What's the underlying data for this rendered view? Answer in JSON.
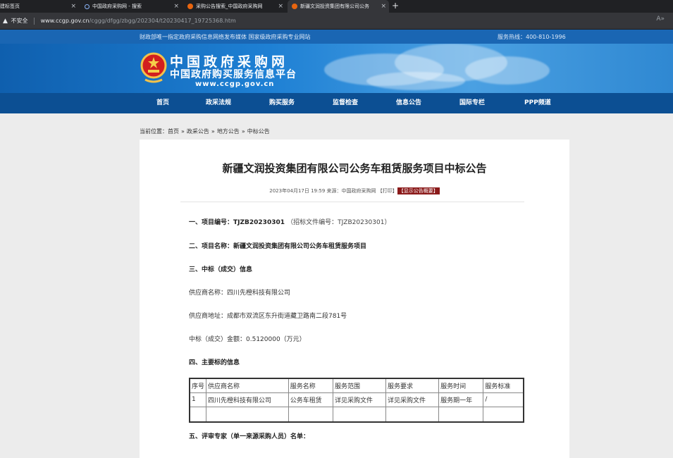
{
  "browser": {
    "tabs": [
      {
        "title": "建标签页",
        "active": false
      },
      {
        "title": "中国政府采购网 - 搜索",
        "active": false
      },
      {
        "title": "采购公告搜索_中国政府采购网",
        "active": false
      },
      {
        "title": "新疆文润投资集团有限公司公务",
        "active": true
      }
    ],
    "security_label": "不安全",
    "url_host": "www.ccgp.gov.cn",
    "url_path": "/cggg/dfgg/zbgg/202304/t20230417_19725368.htm"
  },
  "header": {
    "tagline": "财政部唯一指定政府采购信息网络发布媒体 国家级政府采购专业网站",
    "hotline": "服务热线：400-810-1996",
    "logo_line1": "中国政府采购网",
    "logo_line2": "中国政府购买服务信息平台",
    "logo_en": "www.ccgp.gov.cn"
  },
  "nav": [
    "首页",
    "政采法规",
    "购买服务",
    "监督检查",
    "信息公告",
    "国际专栏",
    "PPP频道"
  ],
  "breadcrumb": {
    "label": "当前位置：",
    "items": [
      "首页",
      "政采公告",
      "地方公告",
      "中标公告"
    ]
  },
  "article": {
    "title": "新疆文润投资集团有限公司公务车租赁服务项目中标公告",
    "meta": "2023年04月17日 19:59 来源：中国政府采购网 【打印】",
    "meta_badge": "【显示公告概要】",
    "project_no_label": "一、项目编号：",
    "project_no": "TJZB20230301",
    "project_no_note": "（招标文件编号：TJZB20230301）",
    "project_name_label": "二、项目名称：",
    "project_name": "新疆文润投资集团有限公司公务车租赁服务项目",
    "section3": "三、中标（成交）信息",
    "supplier_name": "供应商名称：四川先橙科技有限公司",
    "supplier_addr": "供应商地址：成都市双流区东升街道藏卫路南二段781号",
    "amount": "中标（成交）金额：0.5120000（万元）",
    "section4": "四、主要标的信息",
    "table": {
      "headers": [
        "序号",
        "供应商名称",
        "服务名称",
        "服务范围",
        "服务要求",
        "服务时间",
        "服务标准"
      ],
      "rows": [
        [
          "1",
          "四川先橙科技有限公司",
          "公务车租赁",
          "详见采购文件",
          "详见采购文件",
          "服务期一年",
          "/"
        ]
      ]
    },
    "section5": "五、评审专家（单一来源采购人员）名单："
  }
}
